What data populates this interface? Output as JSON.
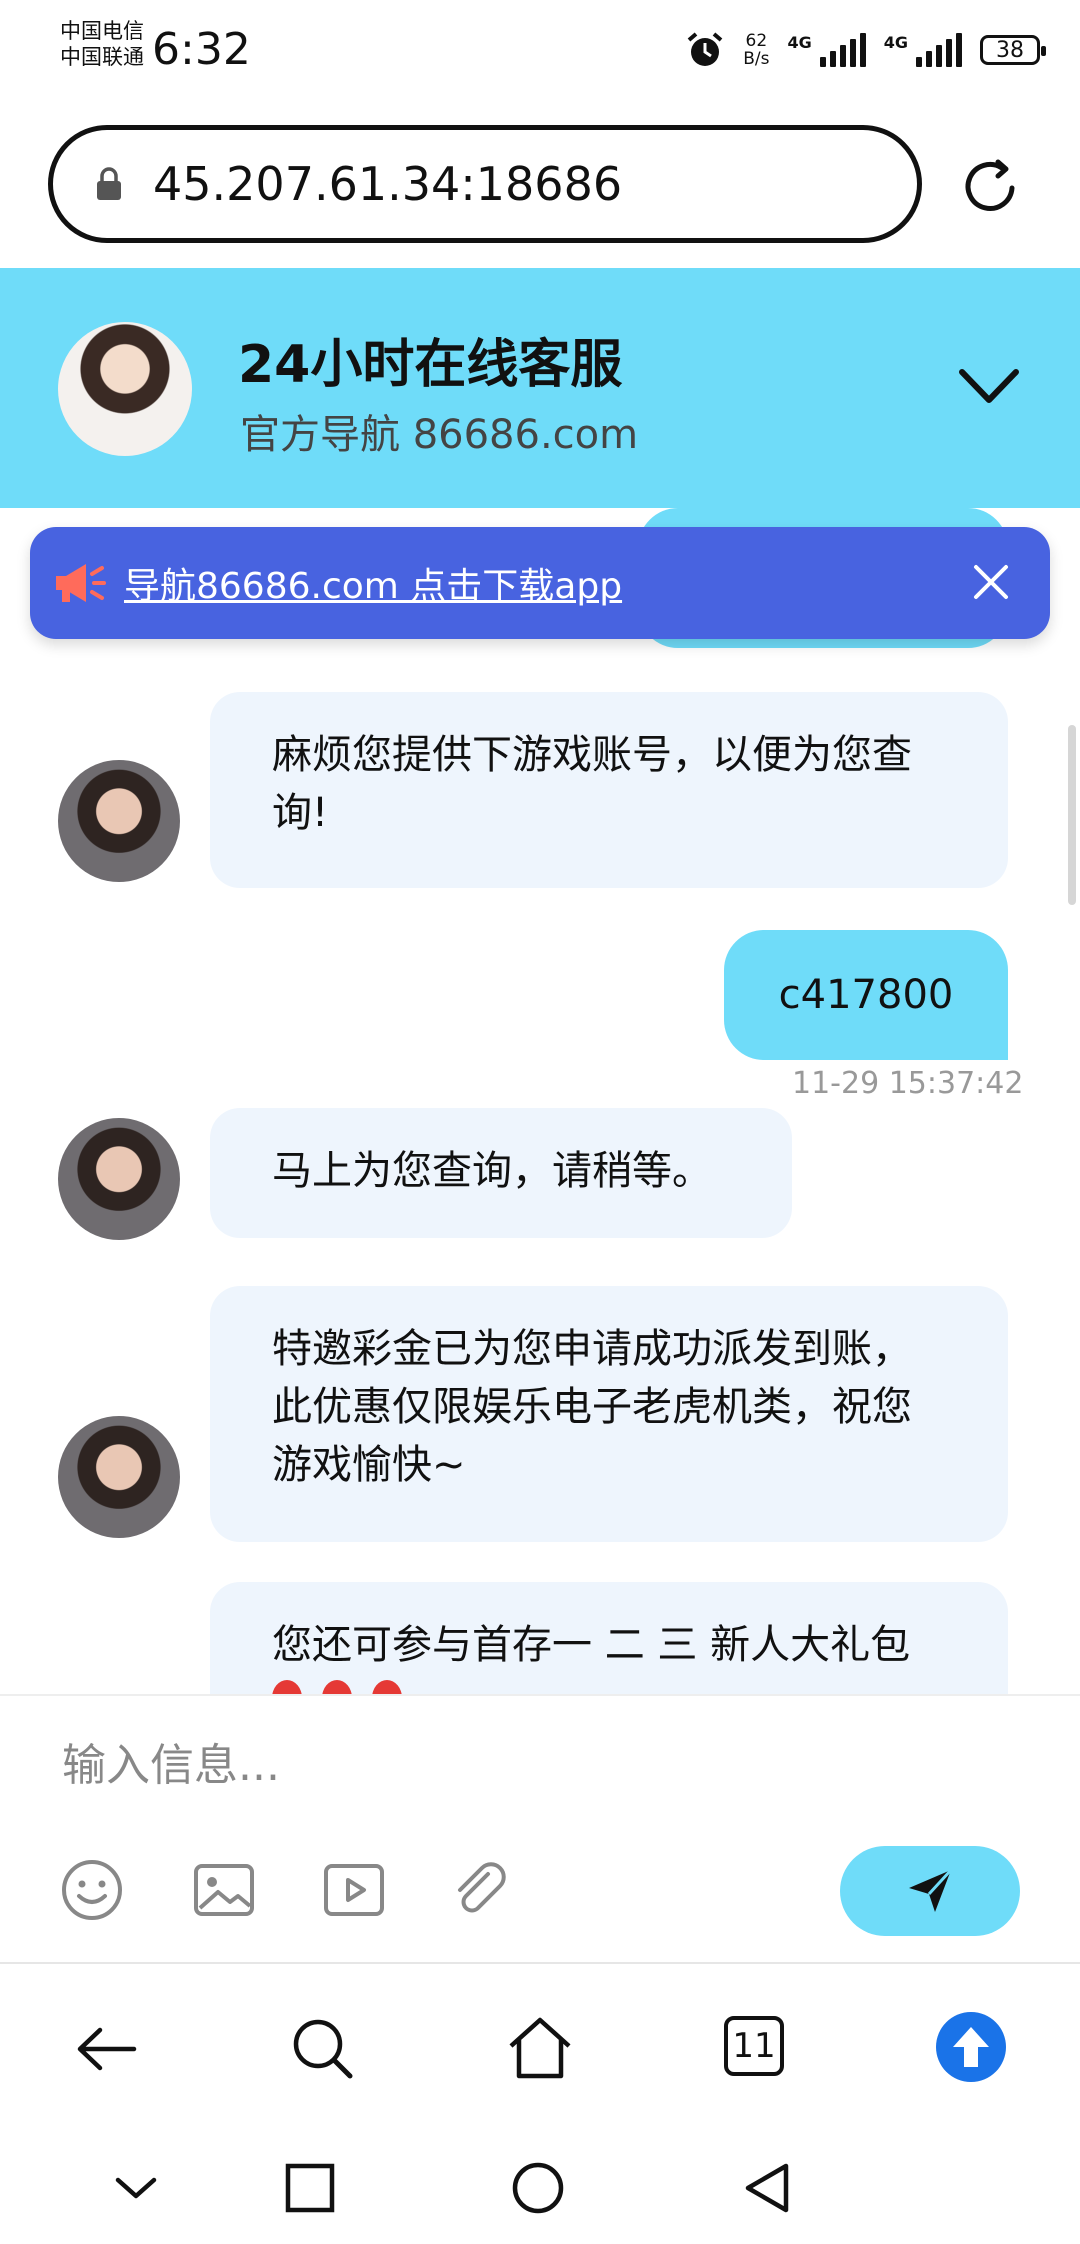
{
  "status_bar": {
    "carrier_1": "中国电信",
    "carrier_2": "中国联通",
    "time": "6:32",
    "net_speed_value": "62",
    "net_speed_unit": "B/s",
    "network_1": "4G",
    "network_2": "4G",
    "battery": "38"
  },
  "browser": {
    "url": "45.207.61.34:18686",
    "tab_count": "11"
  },
  "chat_header": {
    "title": "24小时在线客服",
    "subtitle": "官方导航 86686.com"
  },
  "banner": {
    "text": "导航86686.com 点击下载app"
  },
  "messages": [
    {
      "direction": "in",
      "text": "麻烦您提供下游戏账号，以便为您查询!"
    },
    {
      "direction": "out",
      "text": "c417800",
      "time": "11-29 15:37:42"
    },
    {
      "direction": "in",
      "text": "马上为您查询，请稍等。"
    },
    {
      "direction": "in",
      "text": "特邀彩金已为您申请成功派发到账，此优惠仅限娱乐电子老虎机类，祝您游戏愉快~"
    },
    {
      "direction": "in",
      "text": "您还可参与首存一 二 三 新人大礼包"
    }
  ],
  "composer": {
    "placeholder": "输入信息..."
  },
  "icons": {
    "tools": [
      "emoji-icon",
      "image-icon",
      "video-icon",
      "attachment-icon"
    ],
    "send": "send-icon",
    "nav": [
      "back-icon",
      "search-icon",
      "home-icon",
      "tabs-icon",
      "upgrade-icon"
    ],
    "system": [
      "collapse-icon",
      "recents-icon",
      "home-circle-icon",
      "back-triangle-icon"
    ]
  },
  "colors": {
    "header_bg": "#6fdcf9",
    "banner_bg": "#4863e0",
    "incoming_bubble": "#eef5fd",
    "outgoing_bubble": "#6fdcf9",
    "upgrade_button": "#1a73e8"
  }
}
